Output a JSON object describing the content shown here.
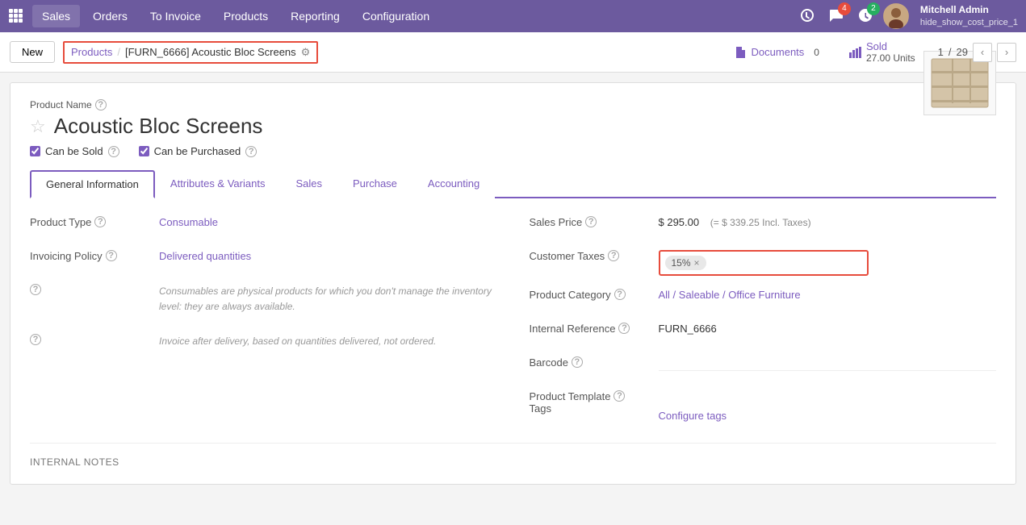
{
  "topnav": {
    "brand_icon": "grid",
    "items": [
      {
        "label": "Sales",
        "active": true
      },
      {
        "label": "Orders"
      },
      {
        "label": "To Invoice"
      },
      {
        "label": "Products"
      },
      {
        "label": "Reporting"
      },
      {
        "label": "Configuration"
      }
    ],
    "notifications_count": "4",
    "updates_count": "2",
    "user_name": "Mitchell Admin",
    "user_subtitle": "hide_show_cost_price_1"
  },
  "breadcrumb": {
    "new_label": "New",
    "parent_link": "Products",
    "current": "[FURN_6666] Acoustic Bloc Screens"
  },
  "smart_buttons": {
    "documents_label": "Documents",
    "documents_count": "0",
    "sold_label": "Sold",
    "sold_value": "27.00 Units"
  },
  "pagination": {
    "current": "1",
    "total": "29"
  },
  "product": {
    "name_field_label": "Product Name",
    "star_tooltip": "Add to favorites",
    "title": "Acoustic Bloc Screens",
    "can_be_sold_label": "Can be Sold",
    "can_be_purchased_label": "Can be Purchased",
    "can_be_sold": true,
    "can_be_purchased": true
  },
  "tabs": [
    {
      "label": "General Information",
      "active": true
    },
    {
      "label": "Attributes & Variants"
    },
    {
      "label": "Sales"
    },
    {
      "label": "Purchase"
    },
    {
      "label": "Accounting"
    }
  ],
  "general_info": {
    "left": {
      "product_type_label": "Product Type",
      "product_type_value": "Consumable",
      "invoicing_policy_label": "Invoicing Policy",
      "invoicing_policy_value": "Delivered quantities",
      "note1": "Consumables are physical products for which you don't manage the\ninventory level: they are always available.",
      "note2": "Invoice after delivery, based on quantities delivered, not ordered."
    },
    "right": {
      "sales_price_label": "Sales Price",
      "sales_price_value": "$ 295.00",
      "sales_price_incl": "(= $ 339.25 Incl. Taxes)",
      "customer_taxes_label": "Customer Taxes",
      "customer_taxes_tag": "15%",
      "product_category_label": "Product Category",
      "product_category_value": "All / Saleable / Office Furniture",
      "internal_reference_label": "Internal Reference",
      "internal_reference_value": "FURN_6666",
      "barcode_label": "Barcode",
      "barcode_value": "",
      "product_template_tags_label": "Product Template\nTags",
      "configure_tags_label": "Configure tags"
    }
  },
  "internal_notes_label": "INTERNAL NOTES"
}
